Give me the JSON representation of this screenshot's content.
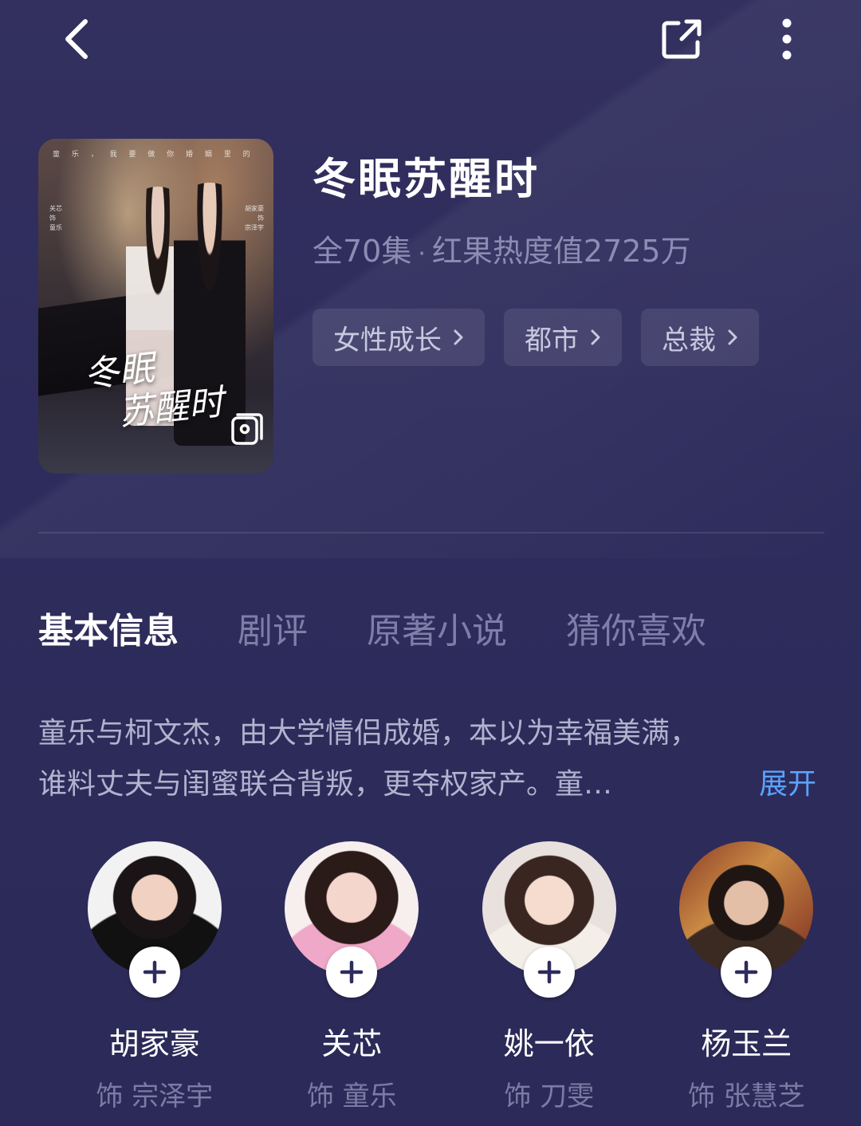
{
  "nav": {
    "back_icon": "chevron-left-icon",
    "share_icon": "share-external-icon",
    "more_icon": "more-vertical-icon"
  },
  "show": {
    "title": "冬眠苏醒时",
    "episodes": "全70集",
    "separator": "·",
    "heat": "红果热度值2725万",
    "tags": [
      {
        "label": "女性成长"
      },
      {
        "label": "都市"
      },
      {
        "label": "总裁"
      }
    ],
    "poster": {
      "tagline": "童 乐 ， 我 要 做 你 婚 姻 里 的 小 三",
      "cast_left": [
        "关芯",
        "饰",
        "童乐"
      ],
      "cast_right": [
        "胡家豪",
        "饰",
        "宗泽宇"
      ],
      "calligraphy_line1": "冬眠",
      "calligraphy_line2": "苏醒时",
      "gallery_icon": "image-gallery-icon"
    }
  },
  "tabs": [
    {
      "label": "基本信息",
      "active": true
    },
    {
      "label": "剧评",
      "active": false
    },
    {
      "label": "原著小说",
      "active": false
    },
    {
      "label": "猜你喜欢",
      "active": false
    }
  ],
  "synopsis": {
    "line1": "童乐与柯文杰，由大学情侣成婚，本以为幸福美满，",
    "line2": "谁料丈夫与闺蜜联合背叛，更夺权家产。童…",
    "expand_label": "展开"
  },
  "cast": [
    {
      "name": "胡家豪",
      "role": "饰 宗泽宇"
    },
    {
      "name": "关芯",
      "role": "饰 童乐"
    },
    {
      "name": "姚一依",
      "role": "饰 刀雯"
    },
    {
      "name": "杨玉兰",
      "role": "饰 张慧芝"
    }
  ],
  "colors": {
    "background": "#2e2c5c",
    "accent_link": "#5aa2ff",
    "muted_text": "#8d8cb3"
  }
}
